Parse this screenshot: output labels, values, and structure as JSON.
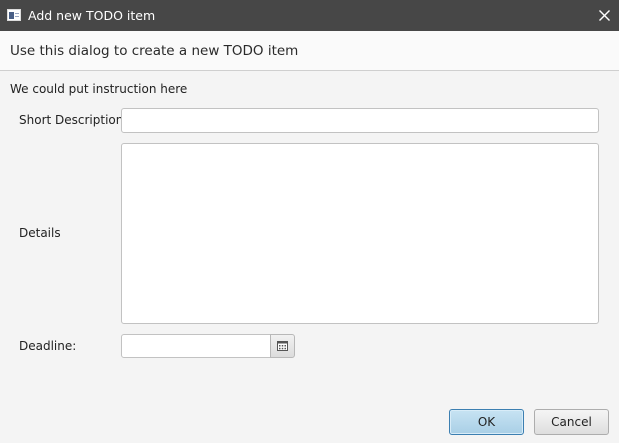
{
  "window": {
    "title": "Add new TODO item",
    "app_icon": "window-icon",
    "close_icon": "close-icon"
  },
  "header": {
    "text": "Use this dialog to create a new TODO item"
  },
  "form": {
    "instruction": "We could put instruction here",
    "short_description": {
      "label": "Short Description",
      "value": ""
    },
    "details": {
      "label": "Details",
      "value": ""
    },
    "deadline": {
      "label": "Deadline:",
      "value": "",
      "picker_icon": "calendar-icon"
    }
  },
  "buttons": {
    "ok": "OK",
    "cancel": "Cancel"
  },
  "colors": {
    "titlebar": "#474747",
    "ok_accent": "#3c7fb1"
  }
}
